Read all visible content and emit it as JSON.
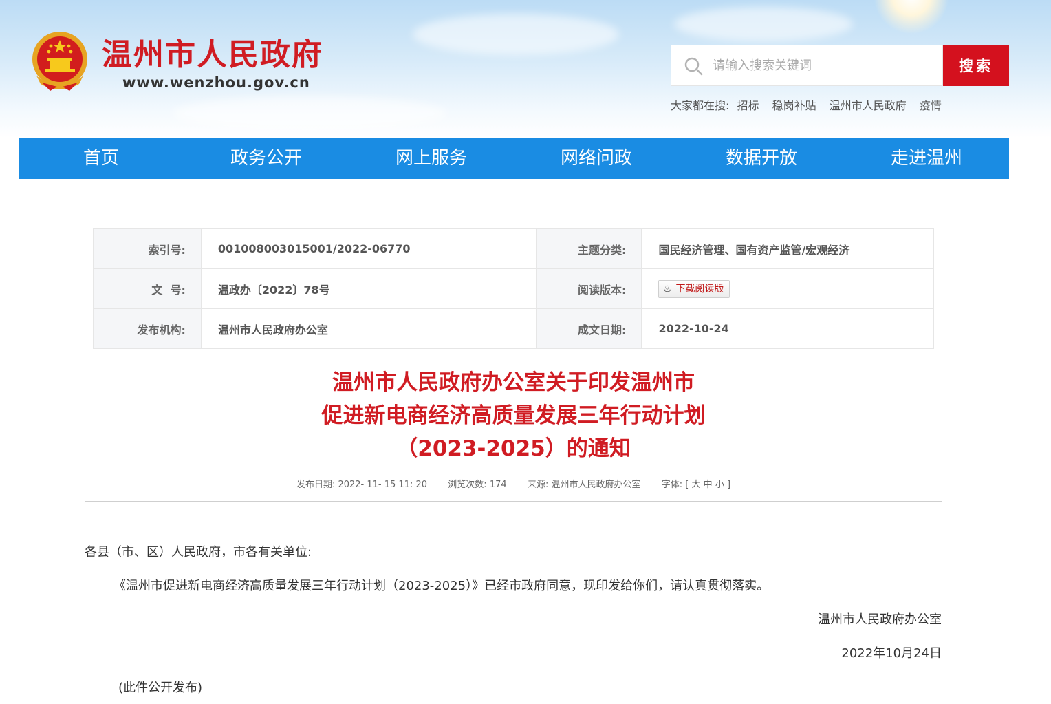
{
  "header": {
    "site_title": "温州市人民政府",
    "site_url": "www.wenzhou.gov.cn",
    "emblem_icon": "national-emblem-icon"
  },
  "search": {
    "placeholder": "请输入搜索关键词",
    "button_label": "搜索",
    "hot_label": "大家都在搜:",
    "hot_terms": [
      "招标",
      "稳岗补贴",
      "温州市人民政府",
      "疫情"
    ]
  },
  "nav": {
    "items": [
      "首页",
      "政务公开",
      "网上服务",
      "网络问政",
      "数据开放",
      "走进温州"
    ]
  },
  "meta": {
    "index_label": "索引号:",
    "index_value": "001008003015001/2022-06770",
    "topic_label": "主题分类:",
    "topic_value": "国民经济管理、国有资产监管/宏观经济",
    "docno_label": "文  号:",
    "docno_value": "温政办〔2022〕78号",
    "version_label": "阅读版本:",
    "download_label": "下载阅读版",
    "agency_label": "发布机构:",
    "agency_value": "温州市人民政府办公室",
    "date_label": "成文日期:",
    "date_value": "2022-10-24"
  },
  "article": {
    "title_line1": "温州市人民政府办公室关于印发温州市",
    "title_line2": "促进新电商经济高质量发展三年行动计划",
    "title_line3": "（2023-2025）的通知",
    "pub_date_label": "发布日期:",
    "pub_date": "2022- 11- 15 11: 20",
    "views_label": "浏览次数:",
    "views": "174",
    "source_label": "来源:",
    "source": "温州市人民政府办公室",
    "font_label": "字体:",
    "font_open": "[",
    "font_large": "大",
    "font_medium": "中",
    "font_small": "小",
    "font_close": "]",
    "salutation": "各县（市、区）人民政府，市各有关单位:",
    "paragraph": "《温州市促进新电商经济高质量发展三年行动计划（2023-2025）》已经市政府同意，现印发给你们，请认真贯彻落实。",
    "signature": "温州市人民政府办公室",
    "sign_date": "2022年10月24日",
    "note": "(此件公开发布)"
  },
  "colors": {
    "brand_red": "#d01c23",
    "nav_blue": "#1a8ce3",
    "search_button": "#d4111e"
  }
}
